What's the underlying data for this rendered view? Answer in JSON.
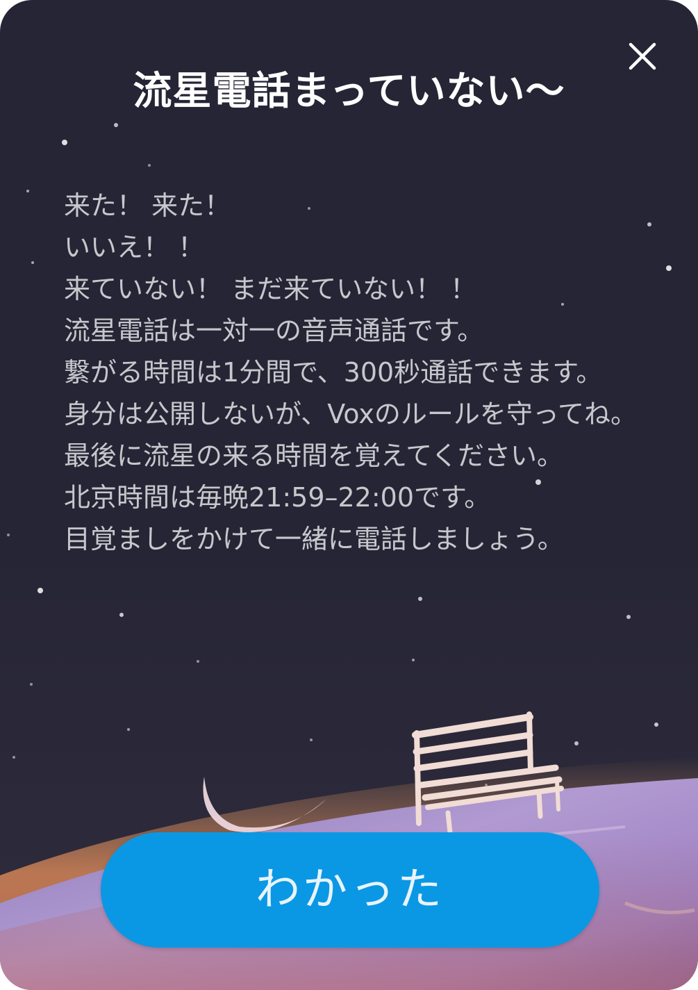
{
  "dialog": {
    "title": "流星電話まっていない〜",
    "close_icon": "close-icon",
    "body_lines": [
      "来た！ 来た！",
      "いいえ！ ！",
      "来ていない！ まだ来ていない！ ！",
      "流星電話は一対一の音声通話です。",
      "繋がる時間は1分間で、300秒通話できます。",
      "身分は公開しないが、Voxのルールを守ってね。",
      "最後に流星の来る時間を覚えてください。",
      "北京時間は毎晩21:59–22:00です。",
      "目覚ましをかけて一緒に電話しましょう。"
    ],
    "confirm_label": "わかった"
  },
  "colors": {
    "background": "#262536",
    "button": "#0a98e4",
    "title_text": "#ffffff",
    "body_text": "#c7c7cc"
  }
}
